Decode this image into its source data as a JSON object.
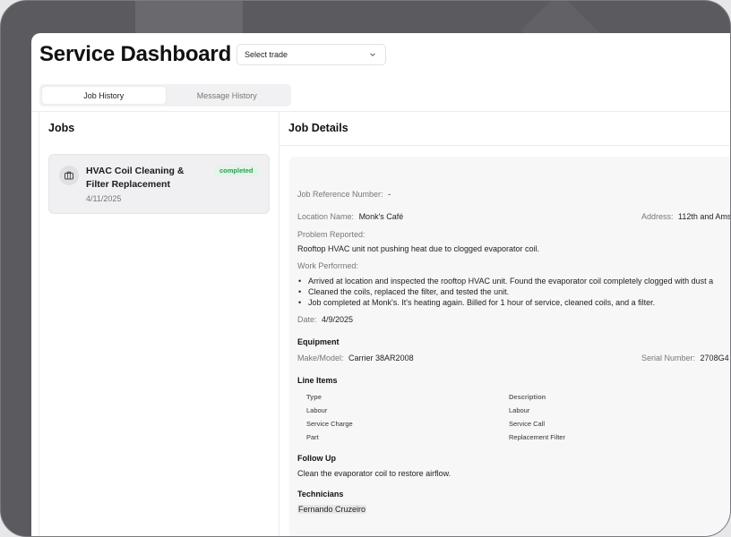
{
  "header": {
    "title": "Service Dashboard",
    "select_trade": {
      "value": "Select trade"
    }
  },
  "tabs": [
    {
      "label": "Job History",
      "active": true
    },
    {
      "label": "Message History",
      "active": false
    }
  ],
  "jobs_panel": {
    "heading": "Jobs",
    "jobs": [
      {
        "title": "HVAC Coil Cleaning & Filter Replacement",
        "status": "completed",
        "date": "4/11/2025"
      }
    ]
  },
  "details_panel": {
    "heading": "Job Details",
    "job_reference": {
      "label": "Job Reference Number:",
      "value": "-"
    },
    "location": {
      "label": "Location Name:",
      "value": "Monk's Café"
    },
    "address": {
      "label": "Address:",
      "value": "112th and Ams"
    },
    "problem": {
      "label": "Problem Reported:",
      "value": "Rooftop HVAC unit not pushing heat due to clogged evaporator coil."
    },
    "work": {
      "label": "Work Performed:",
      "items": [
        "Arrived at location and inspected the rooftop HVAC unit. Found the evaporator coil completely clogged with dust a",
        "Cleaned the coils, replaced the filter, and tested the unit.",
        "Job completed at Monk's. It's heating again. Billed for 1 hour of service, cleaned coils, and a filter."
      ]
    },
    "date": {
      "label": "Date:",
      "value": "4/9/2025"
    },
    "equipment": {
      "heading": "Equipment",
      "make_model": {
        "label": "Make/Model:",
        "value": "Carrier 38AR2008"
      },
      "serial": {
        "label": "Serial Number:",
        "value": "2708G4"
      }
    },
    "line_items": {
      "heading": "Line Items",
      "columns": [
        "Type",
        "Description"
      ],
      "rows": [
        [
          "Labour",
          "Labour"
        ],
        [
          "Service Charge",
          "Service Call"
        ],
        [
          "Part",
          "Replacement Filter"
        ]
      ]
    },
    "follow_up": {
      "heading": "Follow Up",
      "value": "Clean the evaporator coil to restore airflow."
    },
    "technicians": {
      "heading": "Technicians",
      "names": [
        "Fernando Cruzeiro"
      ]
    }
  },
  "colors": {
    "badge_text": "#2f9b57",
    "badge_bg": "#e3f4e8",
    "frame": "#5b5b5f"
  }
}
